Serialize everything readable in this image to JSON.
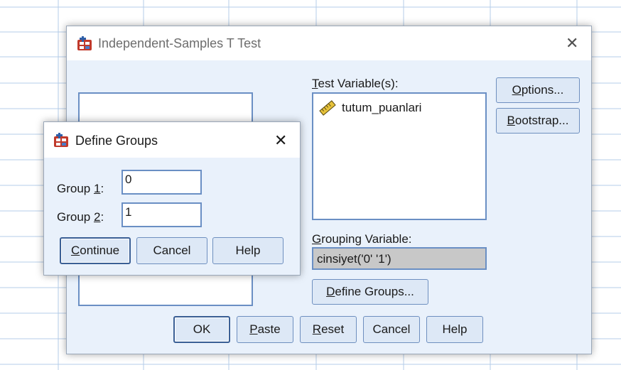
{
  "main_dialog": {
    "title": "Independent-Samples T Test",
    "test_variables_label_key": "T",
    "test_variables_label_rest": "est Variable(s):",
    "test_variables": [
      "tutum_puanlari"
    ],
    "grouping_variable_label_key": "G",
    "grouping_variable_label_rest": "rouping Variable:",
    "grouping_variable_value": "cinsiyet('0' '1')",
    "buttons": {
      "options_key": "O",
      "options_rest": "ptions...",
      "bootstrap_key": "B",
      "bootstrap_rest": "ootstrap...",
      "define_groups_key": "D",
      "define_groups_rest": "efine Groups...",
      "ok": "OK",
      "paste_key": "P",
      "paste_rest": "aste",
      "reset_key": "R",
      "reset_rest": "eset",
      "cancel": "Cancel",
      "help": "Help"
    }
  },
  "define_groups_dialog": {
    "title": "Define Groups",
    "group1_label_pre": "Group ",
    "group1_label_key": "1",
    "group1_label_post": ":",
    "group1_value": "0",
    "group2_label_pre": "Group ",
    "group2_label_key": "2",
    "group2_label_post": ":",
    "group2_value": "1",
    "buttons": {
      "continue_key": "C",
      "continue_rest": "ontinue",
      "cancel": "Cancel",
      "help": "Help"
    }
  },
  "colors": {
    "dialog_bg": "#e9f1fb",
    "button_bg": "#dde8f6",
    "button_border": "#6e8fbf",
    "listbox_border": "#6a8fc4",
    "grouping_field_bg": "#c8c8c8"
  },
  "icons": {
    "app": "spss-app-icon",
    "scale_variable": "ruler-scale-icon",
    "close": "close-icon"
  }
}
